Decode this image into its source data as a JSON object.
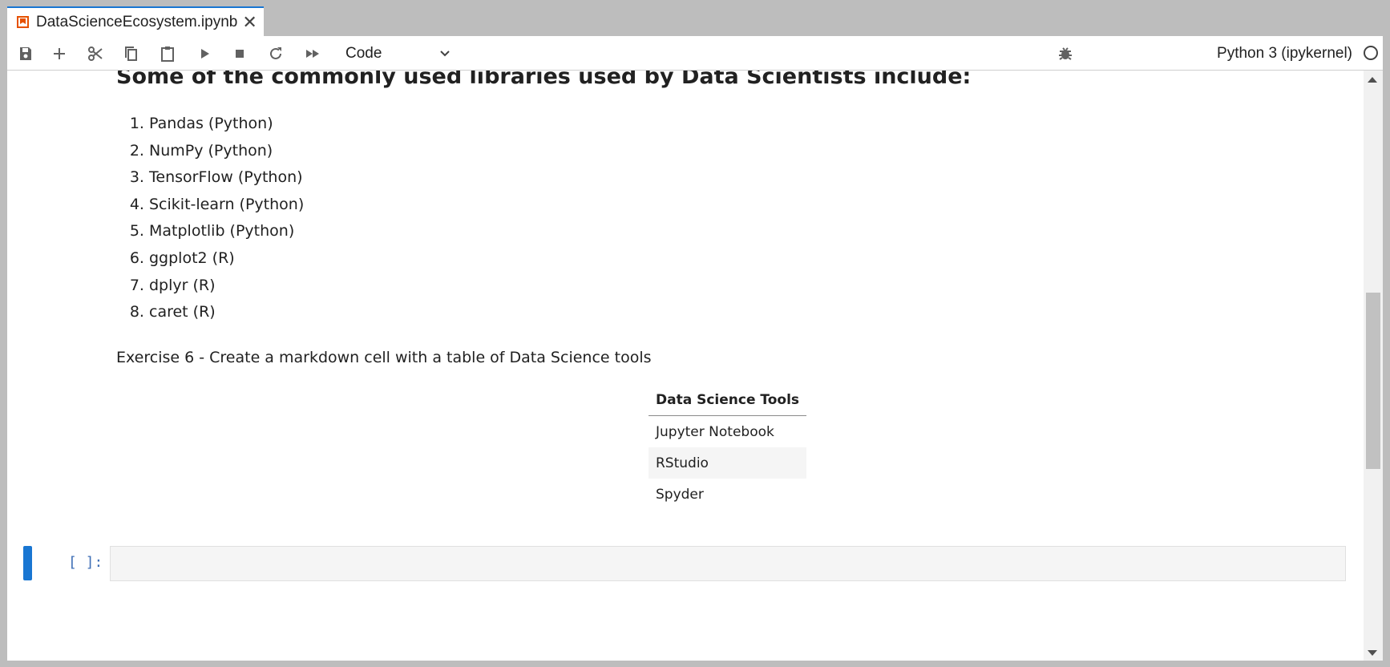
{
  "tab": {
    "title": "DataScienceEcosystem.ipynb",
    "close": "✕"
  },
  "toolbar": {
    "cell_type": "Code",
    "kernel_name": "Python 3 (ipykernel)",
    "icons": [
      "save-icon",
      "add-cell-icon",
      "cut-icon",
      "copy-icon",
      "paste-icon",
      "run-icon",
      "stop-icon",
      "restart-icon",
      "run-all-icon",
      "chevron-down-icon",
      "bug-icon",
      "kernel-status-icon"
    ]
  },
  "markdown": {
    "heading": "Some of the commonly used libraries used by Data Scientists include:",
    "libraries": [
      "Pandas (Python)",
      "NumPy (Python)",
      "TensorFlow (Python)",
      "Scikit-learn (Python)",
      "Matplotlib (Python)",
      "ggplot2 (R)",
      "dplyr (R)",
      "caret (R)"
    ],
    "exercise": "Exercise 6 - Create a markdown cell with a table of Data Science tools",
    "table": {
      "header": "Data Science Tools",
      "rows": [
        "Jupyter Notebook",
        "RStudio",
        "Spyder"
      ]
    }
  },
  "code_cell": {
    "prompt": "[ ]:"
  },
  "colors": {
    "accent": "#1976d2",
    "tab_icon": "#e65100",
    "prompt": "#3f6fb6"
  }
}
